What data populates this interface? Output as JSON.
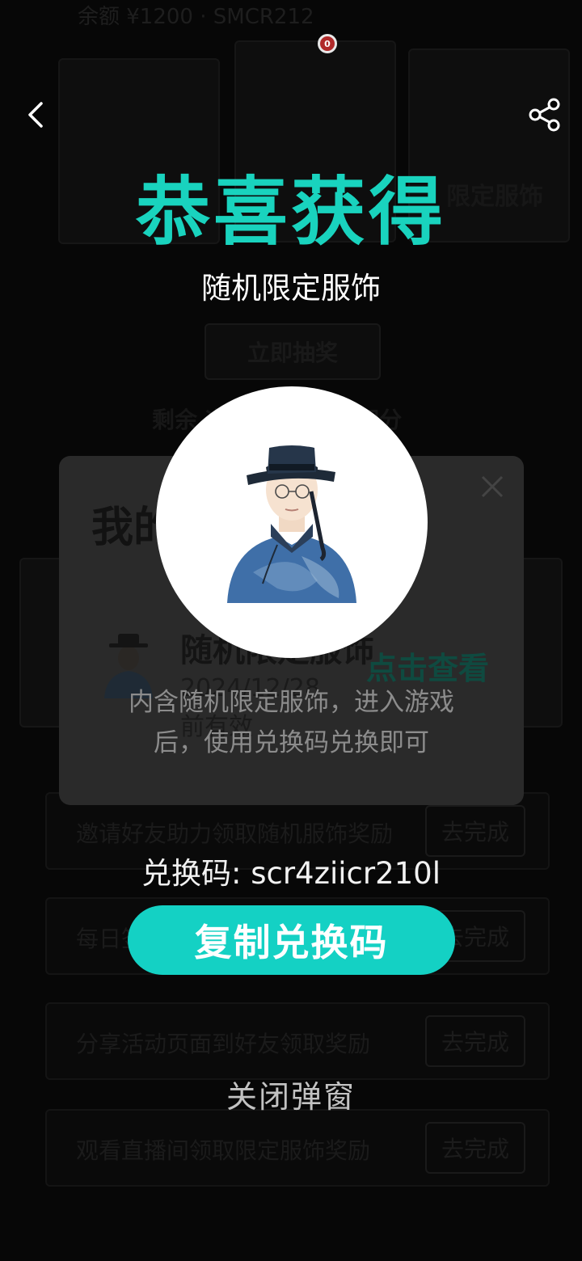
{
  "background": {
    "status_text": "余额 ¥1200 ·  SMCR212",
    "banner_label": "限定服饰",
    "lottery_button": "立即抽奖",
    "remaining_text": "剩余        次抽奖机会共3积分",
    "rows": [
      {
        "text": "邀请好友助力领取随机服饰奖励",
        "button": "去完成"
      },
      {
        "text": "每日签到领取限定积分奖励",
        "button": "去完成"
      },
      {
        "text": "分享活动页面到好友领取奖励",
        "button": "去完成"
      },
      {
        "text": "观看直播间领取限定服饰奖励",
        "button": "去完成"
      }
    ]
  },
  "recording_indicator": {
    "label": "0",
    "color": "#b02a2a"
  },
  "nav": {
    "back_icon": "chevron-left-icon",
    "share_icon": "share-icon"
  },
  "headline": {
    "title": "恭喜获得",
    "subtitle": "随机限定服饰",
    "accent_color": "#19d3be"
  },
  "popup": {
    "title": "我的奖品",
    "item_name": "随机限定服饰",
    "item_date": "2024/12/28",
    "item_note": "前有效",
    "view_link": "点击查看",
    "description_line1": "内含随机限定服饰，进入游戏",
    "description_line2": "后，使用兑换码兑换即可"
  },
  "redeem": {
    "code_label": "兑换码: scr4ziicr210l",
    "copy_button": "复制兑换码",
    "button_color": "#14d1c4",
    "close_label": "关闭弹窗"
  }
}
